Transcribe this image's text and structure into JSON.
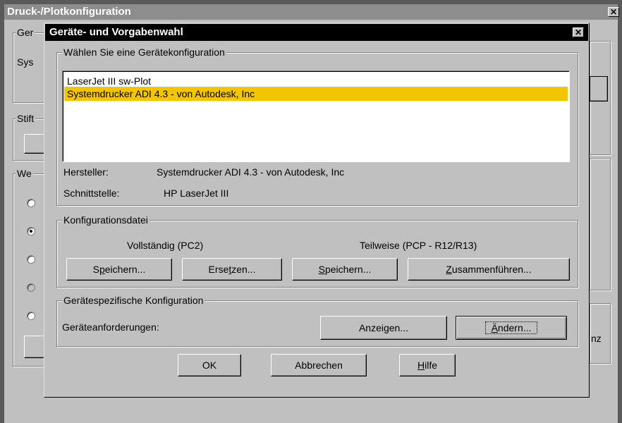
{
  "background_window": {
    "title": "Druck-/Plotkonfiguration",
    "close_label": "✕",
    "fragments": {
      "group1": "Ger",
      "sys": "Sys",
      "stift": "Stift",
      "we": "We",
      "nz": "nz"
    },
    "radios": [
      {
        "state": "off"
      },
      {
        "state": "on"
      },
      {
        "state": "off"
      },
      {
        "state": "disabled"
      },
      {
        "state": "off"
      }
    ]
  },
  "dialog": {
    "title": "Geräte- und Vorgabenwahl",
    "close_label": "✕",
    "device_group": {
      "legend": "Wählen Sie eine Gerätekonfiguration",
      "devices": [
        {
          "label": "LaserJet III sw-Plot",
          "selected": false
        },
        {
          "label": "Systemdrucker ADI 4.3 - von Autodesk, Inc",
          "selected": true
        }
      ],
      "manufacturer_label": "Hersteller:",
      "manufacturer_value": "Systemdrucker ADI 4.3 - von Autodesk, Inc",
      "interface_label": "Schnittstelle:",
      "interface_value": "HP LaserJet III"
    },
    "config_group": {
      "legend": "Konfigurationsdatei",
      "full_label": "Vollständig (PC2)",
      "partial_label": "Teilweise (PCP - R12/R13)",
      "save_full": {
        "pre": "S",
        "ul": "p",
        "post": "eichern..."
      },
      "replace": {
        "pre": "Erse",
        "ul": "t",
        "post": "zen..."
      },
      "save_partial": {
        "pre": "",
        "ul": "S",
        "post": "peichern..."
      },
      "merge": {
        "pre": "",
        "ul": "Z",
        "post": "usammenführen..."
      }
    },
    "device_specific_group": {
      "legend": "Gerätespezifische Konfiguration",
      "requirements_label": "Geräteanforderungen:",
      "show": {
        "pre": "Anzeigen...",
        "ul": "",
        "post": ""
      },
      "change": {
        "pre": "",
        "ul": "Ä",
        "post": "ndern..."
      }
    },
    "ok": "OK",
    "cancel": "Abbrechen",
    "help": {
      "pre": "",
      "ul": "H",
      "post": "ilfe"
    }
  },
  "colors": {
    "selection": "#f2c500",
    "title_bar": "#000000",
    "face": "#c0c0c0"
  }
}
